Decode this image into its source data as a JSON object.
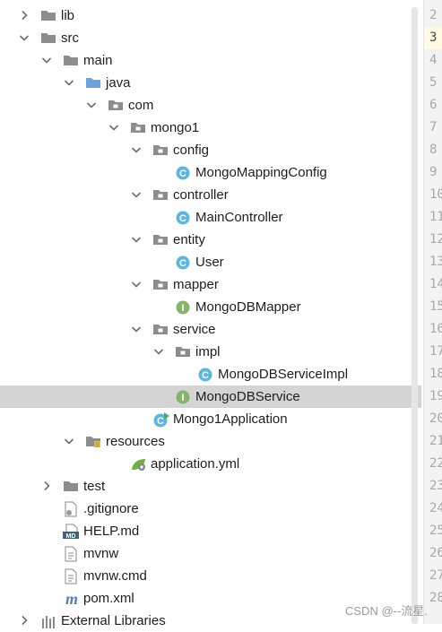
{
  "tree": [
    {
      "label": "lib",
      "icon": "folder-icon",
      "arrow": "collapsed",
      "depth": 0
    },
    {
      "label": "src",
      "icon": "folder-icon",
      "arrow": "expanded",
      "depth": 0
    },
    {
      "label": "main",
      "icon": "folder-icon",
      "arrow": "expanded",
      "depth": 1
    },
    {
      "label": "java",
      "icon": "source-folder-icon",
      "arrow": "expanded",
      "depth": 2
    },
    {
      "label": "com",
      "icon": "package-icon",
      "arrow": "expanded",
      "depth": 3
    },
    {
      "label": "mongo1",
      "icon": "package-icon",
      "arrow": "expanded",
      "depth": 4
    },
    {
      "label": "config",
      "icon": "package-icon",
      "arrow": "expanded",
      "depth": 5
    },
    {
      "label": "MongoMappingConfig",
      "icon": "class-icon",
      "arrow": "none",
      "depth": 6
    },
    {
      "label": "controller",
      "icon": "package-icon",
      "arrow": "expanded",
      "depth": 5
    },
    {
      "label": "MainController",
      "icon": "class-icon",
      "arrow": "none",
      "depth": 6
    },
    {
      "label": "entity",
      "icon": "package-icon",
      "arrow": "expanded",
      "depth": 5
    },
    {
      "label": "User",
      "icon": "class-icon",
      "arrow": "none",
      "depth": 6
    },
    {
      "label": "mapper",
      "icon": "package-icon",
      "arrow": "expanded",
      "depth": 5
    },
    {
      "label": "MongoDBMapper",
      "icon": "interface-icon",
      "arrow": "none",
      "depth": 6
    },
    {
      "label": "service",
      "icon": "package-icon",
      "arrow": "expanded",
      "depth": 5
    },
    {
      "label": "impl",
      "icon": "package-icon",
      "arrow": "expanded",
      "depth": 6
    },
    {
      "label": "MongoDBServiceImpl",
      "icon": "class-icon",
      "arrow": "none",
      "depth": 7
    },
    {
      "label": "MongoDBService",
      "icon": "interface-icon",
      "arrow": "none",
      "depth": 6,
      "selected": true
    },
    {
      "label": "Mongo1Application",
      "icon": "spring-boot-class-icon",
      "arrow": "none",
      "depth": 5
    },
    {
      "label": "resources",
      "icon": "resources-folder-icon",
      "arrow": "expanded",
      "depth": 2
    },
    {
      "label": "application.yml",
      "icon": "spring-config-icon",
      "arrow": "none",
      "depth": 4
    },
    {
      "label": "test",
      "icon": "folder-icon",
      "arrow": "collapsed",
      "depth": 1
    },
    {
      "label": ".gitignore",
      "icon": "gitignore-file-icon",
      "arrow": "none",
      "depth": 1
    },
    {
      "label": "HELP.md",
      "icon": "markdown-file-icon",
      "arrow": "none",
      "depth": 1
    },
    {
      "label": "mvnw",
      "icon": "text-file-icon",
      "arrow": "none",
      "depth": 1
    },
    {
      "label": "mvnw.cmd",
      "icon": "text-file-icon",
      "arrow": "none",
      "depth": 1
    },
    {
      "label": "pom.xml",
      "icon": "maven-icon",
      "arrow": "none",
      "depth": 1
    },
    {
      "label": "External Libraries",
      "icon": "libraries-icon",
      "arrow": "collapsed",
      "depth": 0
    }
  ],
  "gutter": {
    "line_numbers": [
      "2",
      "3",
      "4",
      "5",
      "6",
      "7",
      "8",
      "9",
      "10",
      "11",
      "12",
      "13",
      "14",
      "15",
      "16",
      "17",
      "18",
      "19",
      "20",
      "21",
      "22",
      "23",
      "24",
      "25",
      "26",
      "27",
      "28"
    ],
    "current_line": "3"
  },
  "watermark": "CSDN @--流星."
}
